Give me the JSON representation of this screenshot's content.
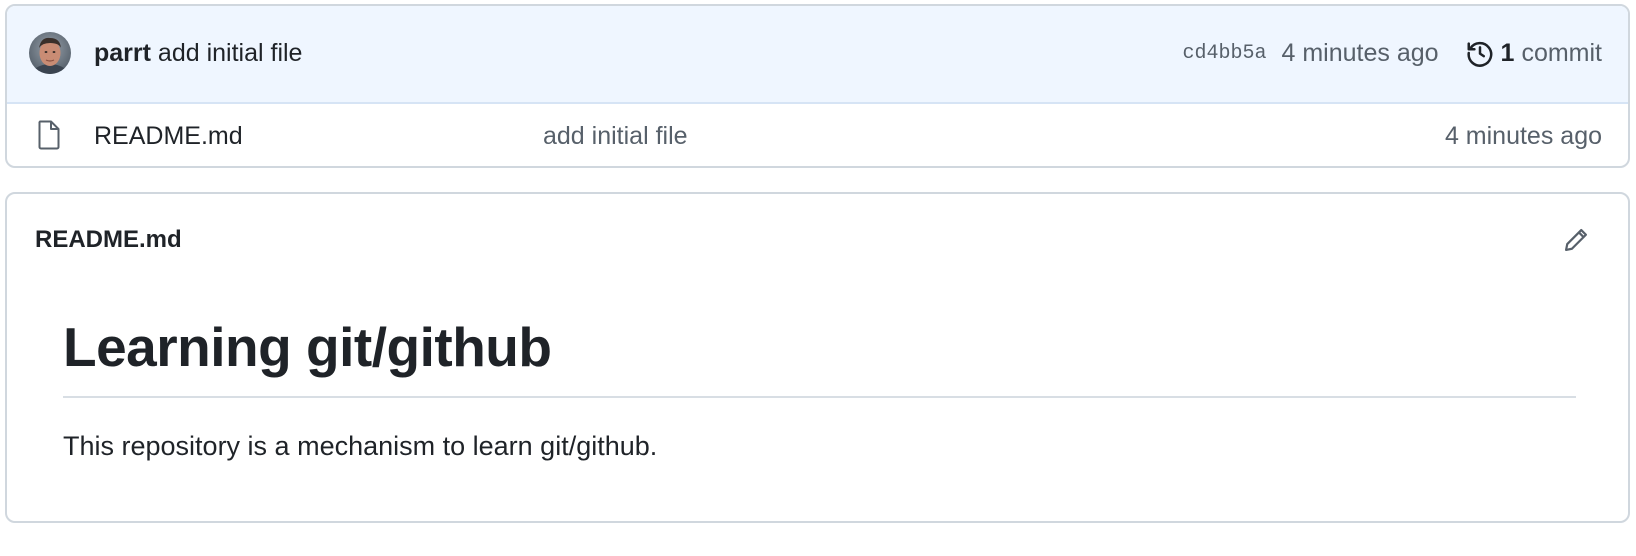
{
  "latest_commit": {
    "author": "parrt",
    "message": "add initial file",
    "sha": "cd4bb5a",
    "time": "4 minutes ago",
    "commit_count": "1",
    "commit_word": "commit",
    "avatar_icon": "user-avatar"
  },
  "files": [
    {
      "icon": "file-icon",
      "name": "README.md",
      "message": "add initial file",
      "time": "4 minutes ago"
    }
  ],
  "readme": {
    "title": "README.md",
    "heading": "Learning git/github",
    "paragraph": "This repository is a mechanism to learn git/github.",
    "edit_icon": "pencil-icon"
  },
  "colors": {
    "commit_bar_bg": "#eff6ff",
    "border": "#d0d7de",
    "text": "#1f2328",
    "muted_text": "#57606a"
  }
}
